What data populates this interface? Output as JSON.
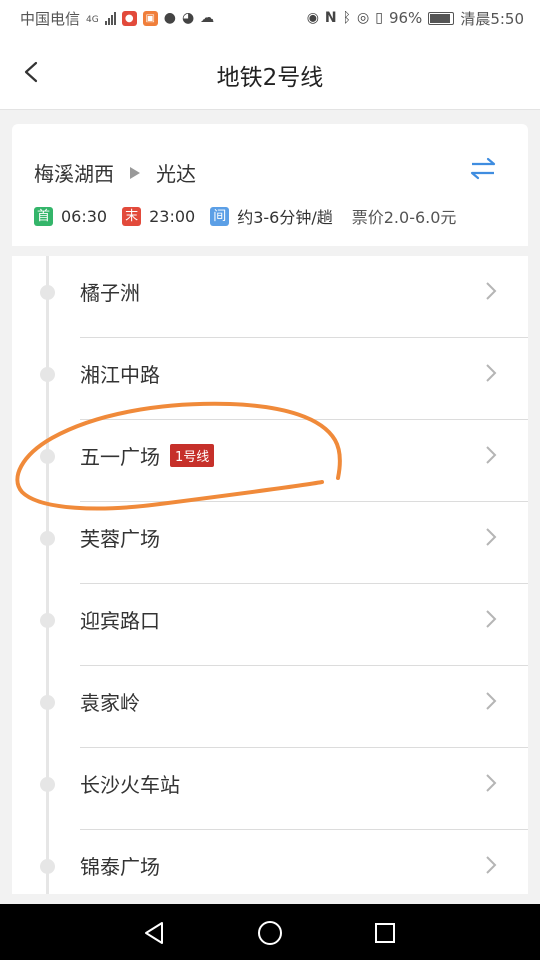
{
  "status_bar": {
    "carrier": "中国电信",
    "network": "4G",
    "battery": "96%",
    "time": "清晨5:50"
  },
  "header": {
    "title": "地铁2号线",
    "back_icon": "chevron-left-icon"
  },
  "route": {
    "from": "梅溪湖西",
    "to": "光达",
    "swap_icon": "swap-arrows-icon",
    "first_tag": "首",
    "first_time": "06:30",
    "last_tag": "末",
    "last_time": "23:00",
    "interval_tag": "间",
    "interval": "约3-6分钟/趟",
    "price": "票价2.0-6.0元",
    "colors": {
      "first": "#34b56a",
      "last": "#e24a3b",
      "interval": "#5b9fe6",
      "swap": "#3f8de0"
    }
  },
  "stations": [
    {
      "name": "橘子洲",
      "transfer": ""
    },
    {
      "name": "湘江中路",
      "transfer": ""
    },
    {
      "name": "五一广场",
      "transfer": "1号线"
    },
    {
      "name": "芙蓉广场",
      "transfer": ""
    },
    {
      "name": "迎宾路口",
      "transfer": ""
    },
    {
      "name": "袁家岭",
      "transfer": ""
    },
    {
      "name": "长沙火车站",
      "transfer": ""
    },
    {
      "name": "锦泰广场",
      "transfer": ""
    }
  ],
  "annotation_color": "#f08a3a",
  "navbar": {
    "back_icon": "triangle-back-icon",
    "home_icon": "circle-home-icon",
    "recents_icon": "square-recents-icon"
  }
}
